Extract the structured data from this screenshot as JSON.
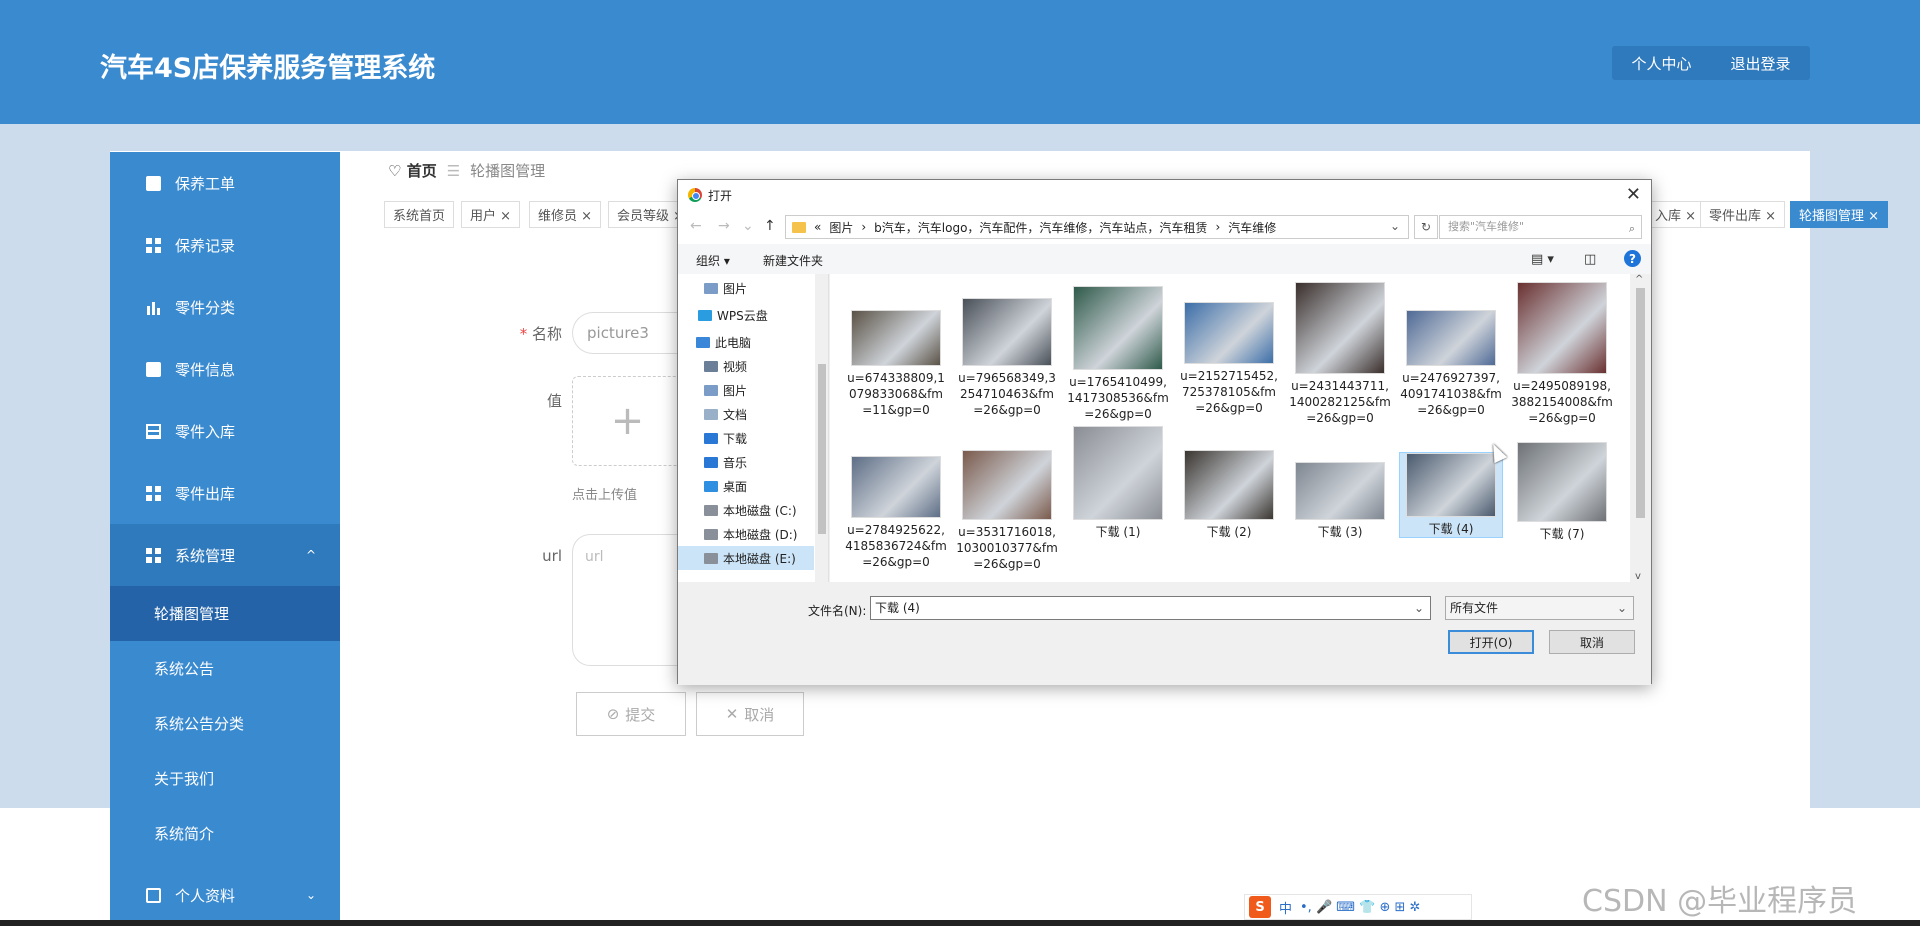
{
  "header": {
    "title": "汽车4S店保养服务管理系统",
    "personal_center": "个人中心",
    "logout": "退出登录"
  },
  "sidebar": {
    "items": [
      {
        "label": "保养工单",
        "icon": "print-icon"
      },
      {
        "label": "保养记录",
        "icon": "grid-icon"
      },
      {
        "label": "零件分类",
        "icon": "bar-chart-icon"
      },
      {
        "label": "零件信息",
        "icon": "ticket-icon"
      },
      {
        "label": "零件入库",
        "icon": "table-icon"
      },
      {
        "label": "零件出库",
        "icon": "grid-icon"
      },
      {
        "label": "系统管理",
        "icon": "grid-icon",
        "chevron": "^"
      }
    ],
    "subitems": [
      "轮播图管理",
      "系统公告",
      "系统公告分类",
      "关于我们",
      "系统简介"
    ],
    "profile": {
      "label": "个人资料",
      "chevron": "⌄"
    }
  },
  "breadcrumb": {
    "home": "首页",
    "separator": "☰",
    "current": "轮播图管理"
  },
  "tabs": [
    "系统首页",
    "用户 ×",
    "维修员 ×",
    "会员等级 ×",
    "入库 ×",
    "零件出库 ×",
    "轮播图管理 ×"
  ],
  "form": {
    "name_label": "名称",
    "name_value": "picture3",
    "value_label": "值",
    "upload_plus": "+",
    "upload_hint": "点击上传值",
    "url_label": "url",
    "url_placeholder": "url",
    "submit": "提交",
    "cancel": "取消"
  },
  "dialog": {
    "title": "打开",
    "close": "✕",
    "path_prefix": "«",
    "path": [
      "图片",
      "b汽车，汽车logo，汽车配件，汽车维修，汽车站点，汽车租赁",
      "汽车维修"
    ],
    "path_sep": "›",
    "search_placeholder": "搜索\"汽车维修\"",
    "organize": "组织 ▾",
    "new_folder": "新建文件夹",
    "help": "?",
    "tree": [
      {
        "label": "图片",
        "type": "pictures"
      },
      {
        "label": "WPS云盘",
        "type": "cloud"
      },
      {
        "label": "此电脑",
        "type": "pc"
      },
      {
        "label": "视频",
        "type": "video"
      },
      {
        "label": "图片",
        "type": "pictures"
      },
      {
        "label": "文档",
        "type": "docs"
      },
      {
        "label": "下载",
        "type": "download"
      },
      {
        "label": "音乐",
        "type": "music"
      },
      {
        "label": "桌面",
        "type": "desktop"
      },
      {
        "label": "本地磁盘 (C:)",
        "type": "disk"
      },
      {
        "label": "本地磁盘 (D:)",
        "type": "disk"
      },
      {
        "label": "本地磁盘 (E:)",
        "type": "disk",
        "selected": true
      }
    ],
    "files": [
      {
        "name": "u=674338809,1079833068&fm=11&gp=0",
        "color": "#5a5246"
      },
      {
        "name": "u=796568349,3254710463&fm=26&gp=0",
        "color": "#4a5058"
      },
      {
        "name": "u=1765410499,1417308536&fm=26&gp=0",
        "color": "#2f5a4a"
      },
      {
        "name": "u=2152715452,725378105&fm=26&gp=0",
        "color": "#3c6ea8"
      },
      {
        "name": "u=2431443711,1400282125&fm=26&gp=0",
        "color": "#3a2f2c"
      },
      {
        "name": "u=2476927397,4091741038&fm=26&gp=0",
        "color": "#4f6a96"
      },
      {
        "name": "u=2495089198,3882154008&fm=26&gp=0",
        "color": "#6a3030"
      },
      {
        "name": "u=2784925622,4185836724&fm=26&gp=0",
        "color": "#5e6e86"
      },
      {
        "name": "u=3531716018,1030010377&fm=26&gp=0",
        "color": "#7a5a4c"
      },
      {
        "name": "下载 (1)",
        "color": "#8a8e94"
      },
      {
        "name": "下载 (2)",
        "color": "#3a3530"
      },
      {
        "name": "下载 (3)",
        "color": "#7e8690"
      },
      {
        "name": "下载 (4)",
        "color": "#4a5a6e",
        "selected": true
      },
      {
        "name": "下载 (7)",
        "color": "#6e7276"
      }
    ],
    "filename_label": "文件名(N):",
    "filename_value": "下载 (4)",
    "filetype": "所有文件",
    "open": "打开(O)",
    "cancel": "取消"
  },
  "watermark": "CSDN @毕业程序员",
  "ime": {
    "logo": "S",
    "mode": "中",
    "icons": "•, 🎤 ⌨ 👕 ⊕ ⊞ ✲"
  }
}
